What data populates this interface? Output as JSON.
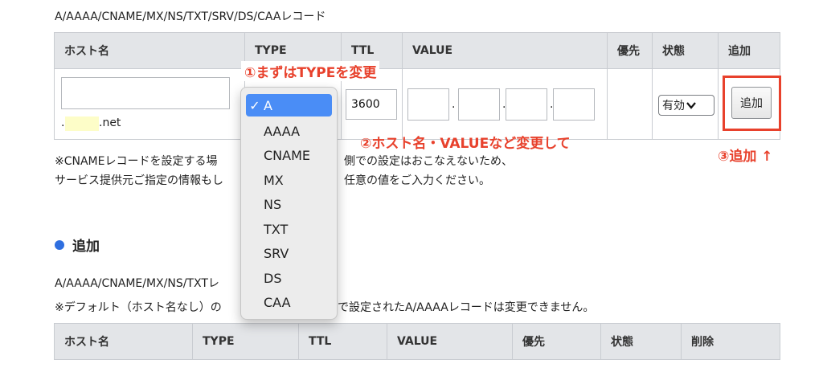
{
  "top_caption": "A/AAAA/CNAME/MX/NS/TXT/SRV/DS/CAAレコード",
  "table1": {
    "headers": [
      "ホスト名",
      "TYPE",
      "TTL",
      "VALUE",
      "優先",
      "状態",
      "追加"
    ],
    "host_suffix": ".net",
    "ttl_value": "3600",
    "value_dots": [
      ".",
      ".",
      "."
    ],
    "status_select": "有効",
    "add_button": "追加"
  },
  "type_dropdown": {
    "options": [
      "A",
      "AAAA",
      "CNAME",
      "MX",
      "NS",
      "TXT",
      "SRV",
      "DS",
      "CAA"
    ],
    "selected": "A",
    "check_mark": "✓"
  },
  "annotations": {
    "step1": "①まずはTYPEを変更",
    "step2": "②ホスト名・VALUEなど変更して",
    "step3": "③追加 ↑"
  },
  "notes": {
    "line1_a": "※CNAMEレコードを設定する場",
    "line1_b": "側での設定はおこなえないため、",
    "line2_a": "サービス提供元ご指定の情報もし",
    "line2_b": "任意の値をご入力ください。"
  },
  "section2": {
    "title": "追加",
    "caption": "A/AAAA/CNAME/MX/NS/TXTレ",
    "note_a": "※デフォルト（ホスト名なし）の",
    "note_b": "で設定されたA/AAAAレコードは変更できません。"
  },
  "table2": {
    "headers": [
      "ホスト名",
      "TYPE",
      "TTL",
      "VALUE",
      "優先",
      "状態",
      "削除"
    ]
  },
  "colors": {
    "accent_red": "#e8412c",
    "selection_blue": "#4a8df6",
    "header_gray": "#e3e5e8",
    "bullet_blue": "#2f6fe0"
  }
}
